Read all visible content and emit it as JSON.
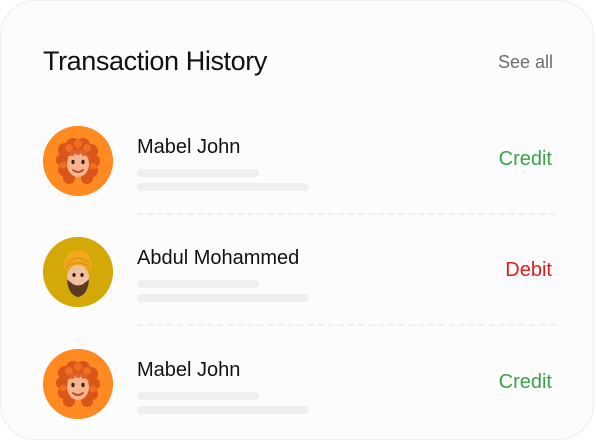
{
  "header": {
    "title": "Transaction History",
    "see_all": "See all"
  },
  "transactions": [
    {
      "name": "Mabel John",
      "type": "Credit",
      "avatar": "curly-hair-avatar-icon",
      "avatar_bg": "#ff8a21"
    },
    {
      "name": "Abdul Mohammed",
      "type": "Debit",
      "avatar": "turban-avatar-icon",
      "avatar_bg": "#d4a806"
    },
    {
      "name": "Mabel John",
      "type": "Credit",
      "avatar": "curly-hair-avatar-icon",
      "avatar_bg": "#ff8a21"
    }
  ],
  "colors": {
    "credit": "#3aa24a",
    "debit": "#e31b1b"
  }
}
